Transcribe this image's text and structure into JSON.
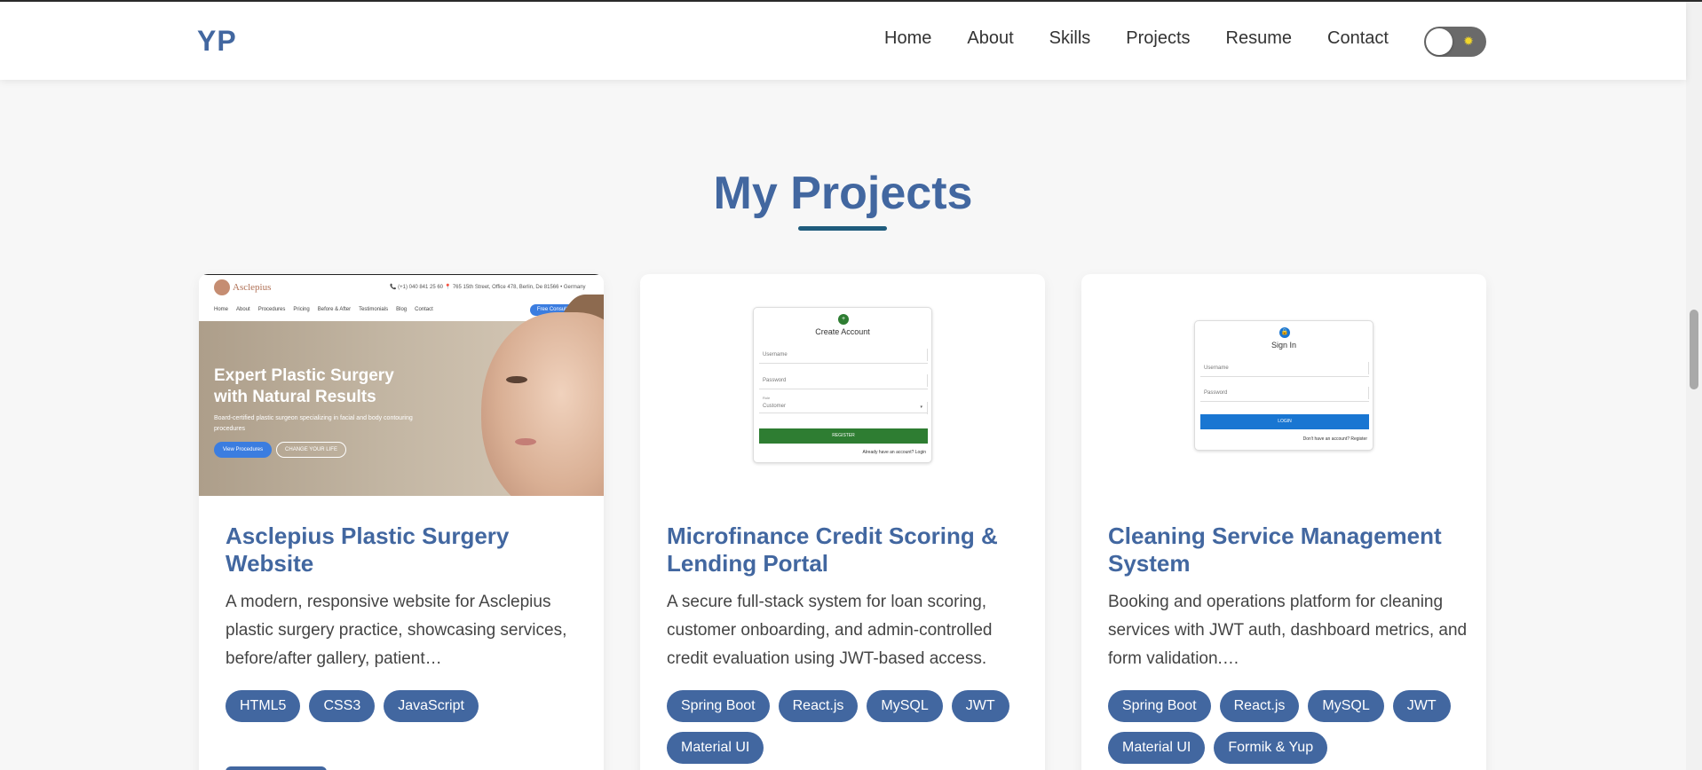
{
  "navbar": {
    "logo": "YP",
    "links": [
      "Home",
      "About",
      "Skills",
      "Projects",
      "Resume",
      "Contact"
    ],
    "theme_toggle_icon": "sun-icon"
  },
  "section": {
    "title": "My Projects"
  },
  "projects": [
    {
      "title": "Asclepius Plastic Surgery Website",
      "description": "A modern, responsive website for Asclepius plastic surgery practice, showcasing services, before/after gallery, patient…",
      "tags": [
        "HTML5",
        "CSS3",
        "JavaScript"
      ],
      "thumb": {
        "brand": "Asclepius",
        "contact": "📞 (+1) 040 841 25 60   📍 765 15th Street, Office 478, Berlin, De 81566 • Germany",
        "nav": [
          "Home",
          "About",
          "Procedures",
          "Pricing",
          "Before & After",
          "Testimonials",
          "Blog",
          "Contact"
        ],
        "cta": "Free Consultation",
        "headline": "Expert Plastic Surgery with Natural Results",
        "subtext": "Board-certified plastic surgeon specializing in facial and body contouring procedures",
        "btn_primary": "View Procedures",
        "btn_secondary": "CHANGE YOUR LIFE"
      }
    },
    {
      "title": "Microfinance Credit Scoring & Lending Portal",
      "description": "A secure full-stack system for loan scoring, customer onboarding, and admin-controlled credit evaluation using JWT-based access.",
      "tags": [
        "Spring Boot",
        "React.js",
        "MySQL",
        "JWT",
        "Material UI"
      ],
      "thumb": {
        "form_title": "Create Account",
        "field_1": "Username",
        "field_2": "Password",
        "select_label": "Role",
        "select_value": "Customer",
        "button": "REGISTER",
        "footer": "Already have an account? Login"
      }
    },
    {
      "title": "Cleaning Service Management System",
      "description": "Booking and operations platform for cleaning services with JWT auth, dashboard metrics, and form validation.…",
      "tags": [
        "Spring Boot",
        "React.js",
        "MySQL",
        "JWT",
        "Material UI",
        "Formik & Yup"
      ],
      "thumb": {
        "form_title": "Sign In",
        "field_1": "Username",
        "field_2": "Password",
        "button": "LOGIN",
        "footer": "Don't have an account? Register"
      }
    }
  ],
  "colors": {
    "accent": "#4267a0",
    "underline": "#1f5c7d",
    "register_green": "#2e7d32",
    "login_blue": "#1976d2"
  }
}
